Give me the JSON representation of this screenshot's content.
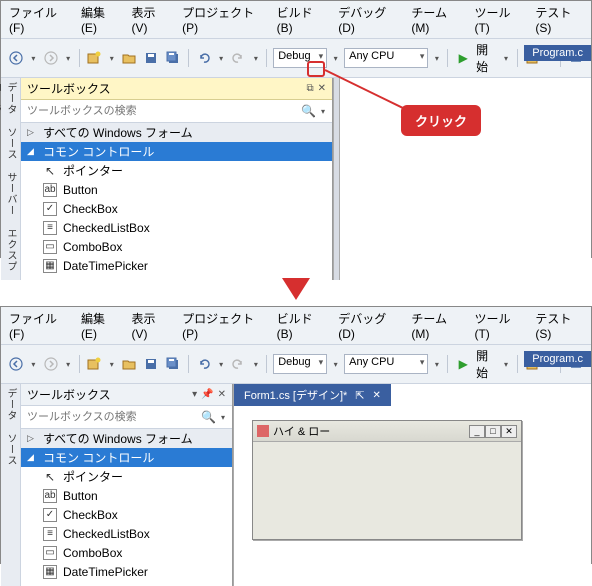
{
  "menu": [
    "ファイル(F)",
    "編集(E)",
    "表示(V)",
    "プロジェクト(P)",
    "ビルド(B)",
    "デバッグ(D)",
    "チーム(M)",
    "ツール(T)",
    "テスト(S)"
  ],
  "toolbar": {
    "config": "Debug",
    "platform": "Any CPU",
    "start_label": "開始"
  },
  "program_label": "Program.c",
  "vstrip_top": "データ ソース  サーバー エクスプローラー",
  "vstrip_bottom": "データ ソース",
  "toolbox": {
    "title": "ツールボックス",
    "search_placeholder": "ツールボックスの検索",
    "group_all": "すべての Windows フォーム",
    "group_common": "コモン コントロール",
    "items": [
      {
        "icon": "cursor",
        "label": "ポインター"
      },
      {
        "icon": "ab",
        "label": "Button"
      },
      {
        "icon": "check",
        "label": "CheckBox"
      },
      {
        "icon": "list",
        "label": "CheckedListBox"
      },
      {
        "icon": "combo",
        "label": "ComboBox"
      },
      {
        "icon": "date",
        "label": "DateTimePicker"
      }
    ]
  },
  "callout": {
    "text": "クリック"
  },
  "doc_tab": "Form1.cs [デザイン]*",
  "form_window_title": "ハイ & ロー"
}
